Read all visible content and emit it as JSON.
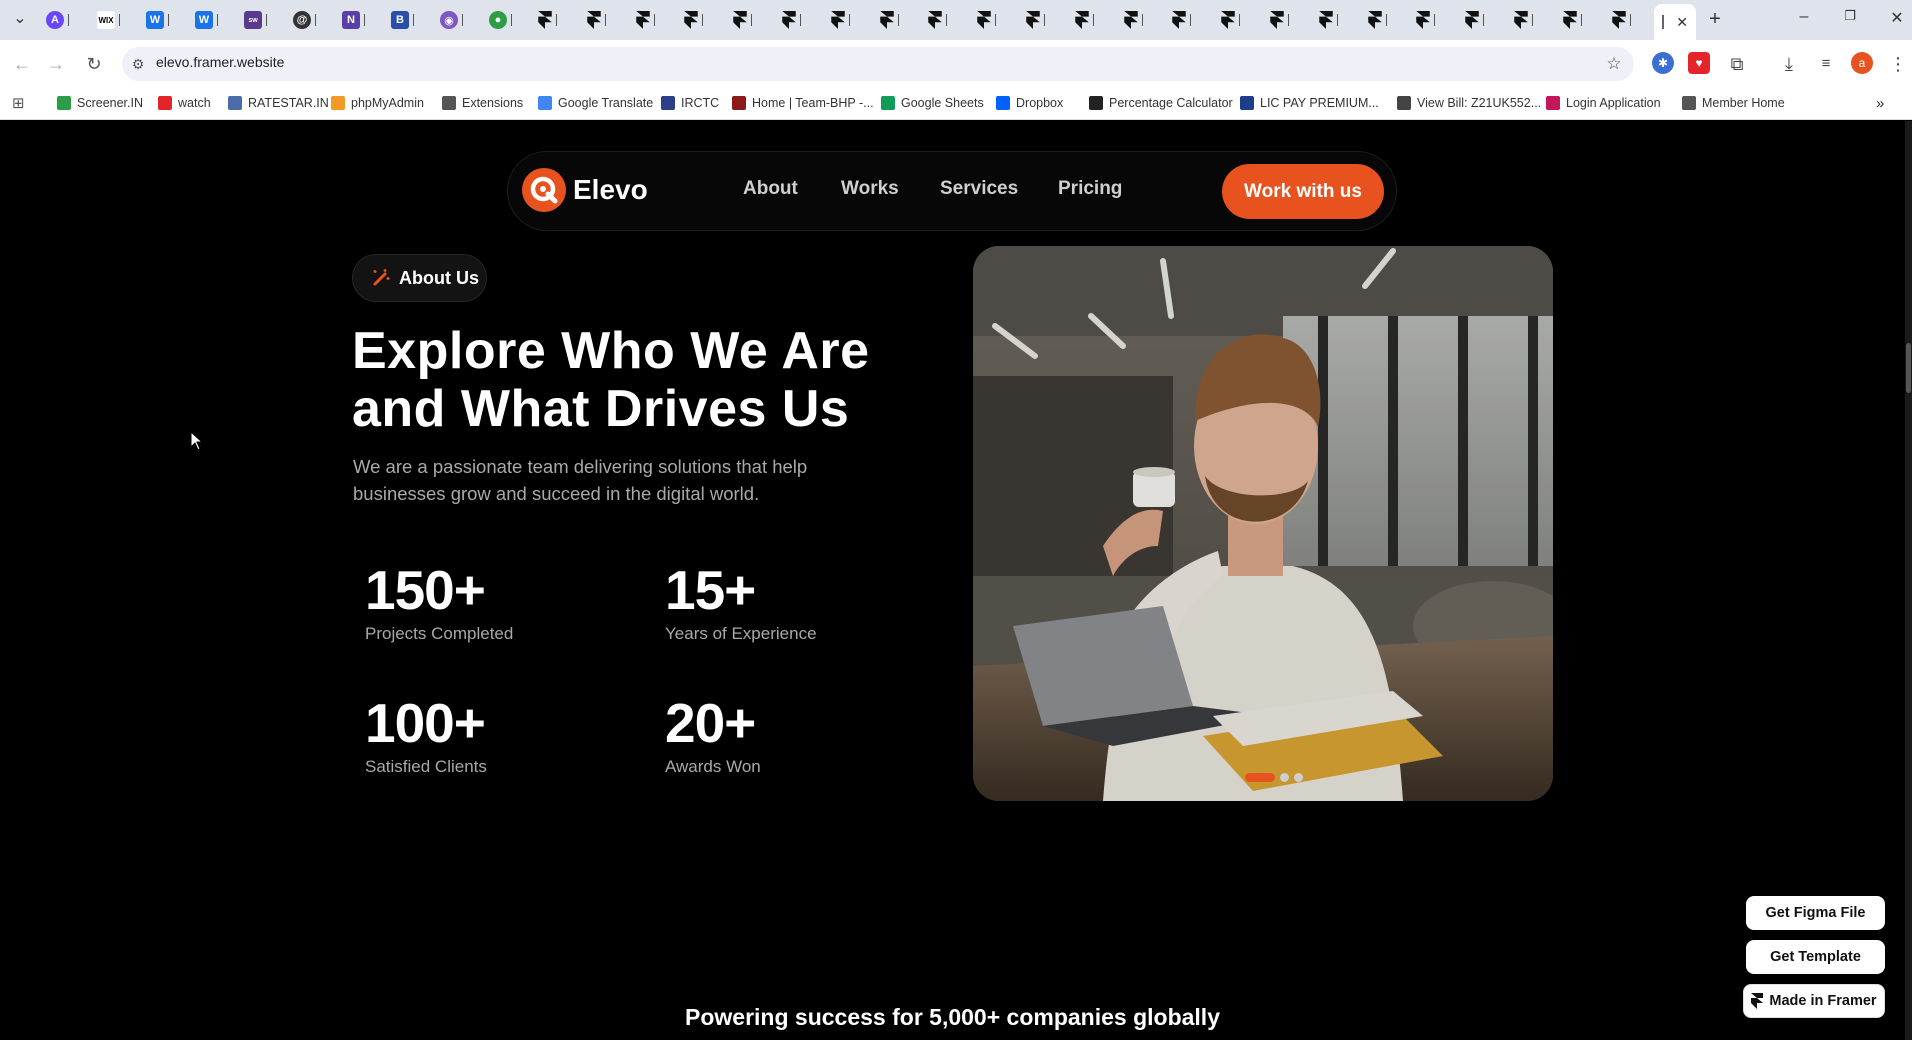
{
  "browser": {
    "url": "elevo.framer.website",
    "bookmarks": [
      {
        "label": "Screener.IN",
        "color": "#2e9d48"
      },
      {
        "label": "watch",
        "color": "#e3252b"
      },
      {
        "label": "RATESTAR.IN",
        "color": "#4a6da8"
      },
      {
        "label": "phpMyAdmin",
        "color": "#f29a25"
      },
      {
        "label": "Extensions",
        "color": "#555555"
      },
      {
        "label": "Google Translate",
        "color": "#4285f4"
      },
      {
        "label": "IRCTC",
        "color": "#2b3f8a"
      },
      {
        "label": "Home | Team-BHP -...",
        "color": "#8b1a1a"
      },
      {
        "label": "Google Sheets",
        "color": "#0f9d58"
      },
      {
        "label": "Dropbox",
        "color": "#0061fe"
      },
      {
        "label": "Percentage Calculator",
        "color": "#222222"
      },
      {
        "label": "LIC PAY PREMIUM...",
        "color": "#1e3e8c"
      },
      {
        "label": "View Bill: Z21UK552...",
        "color": "#444444"
      },
      {
        "label": "Login Application",
        "color": "#c2185b"
      },
      {
        "label": "Member Home",
        "color": "#555555"
      }
    ]
  },
  "nav": {
    "brand": "Elevo",
    "links": [
      "About",
      "Works",
      "Services",
      "Pricing"
    ],
    "cta": "Work with us"
  },
  "hero": {
    "badge": "About Us",
    "headline_line1": "Explore Who We Are",
    "headline_line2": "and What Drives Us",
    "subtext": "We are a passionate team delivering solutions that help businesses grow and succeed in the digital world.",
    "stats": [
      {
        "value": "150+",
        "label": "Projects Completed"
      },
      {
        "value": "15+",
        "label": "Years of Experience"
      },
      {
        "value": "100+",
        "label": "Satisfied Clients"
      },
      {
        "value": "20+",
        "label": "Awards Won"
      }
    ],
    "carousel": {
      "slides": 3,
      "active": 1
    }
  },
  "tagline": "Powering success for 5,000+ companies globally",
  "floating": {
    "figma": "Get Figma File",
    "template": "Get Template",
    "framer": "Made in Framer"
  },
  "colors": {
    "accent": "#e8521f",
    "background": "#000000"
  }
}
